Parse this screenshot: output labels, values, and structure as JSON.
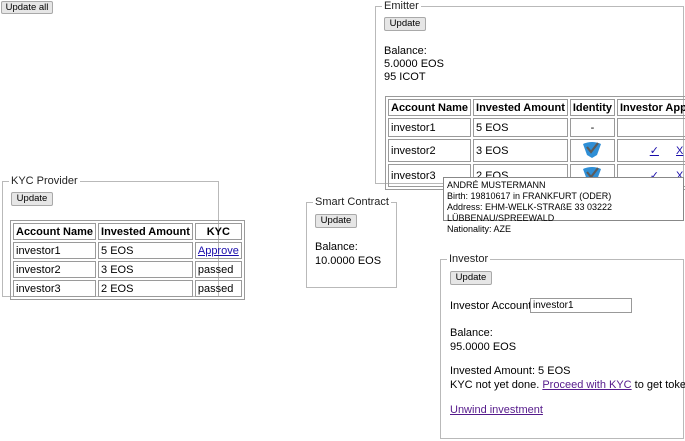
{
  "update_all_label": "Update all",
  "emitter": {
    "title": "Emitter",
    "update_label": "Update",
    "balance_label": "Balance:",
    "balance_eos": "5.0000 EOS",
    "balance_icot": "95 ICOT",
    "columns": [
      "Account Name",
      "Invested Amount",
      "Identity",
      "Investor Approval"
    ],
    "rows": [
      {
        "account": "investor1",
        "amount": "5 EOS",
        "identity": "-"
      },
      {
        "account": "investor2",
        "amount": "3 EOS",
        "identity": "verified-shield-icon",
        "approve": "✓",
        "reject": "X"
      },
      {
        "account": "investor3",
        "amount": "2 EOS",
        "identity": "verified-shield-icon",
        "approve": "✓",
        "reject": "X"
      }
    ]
  },
  "tooltip": {
    "name": "ANDRÉ MUSTERMANN",
    "birth": "Birth: 19810617 in FRANKFURT (ODER)",
    "address": "Address: EHM-WELK-STRAßE 33 03222 LÜBBENAU/SPREEWALD",
    "nationality": "Nationality: AZE"
  },
  "kyc_provider": {
    "title": "KYC Provider",
    "update_label": "Update",
    "columns": [
      "Account Name",
      "Invested Amount",
      "KYC"
    ],
    "rows": [
      {
        "account": "investor1",
        "amount": "5 EOS",
        "kyc": "Approve"
      },
      {
        "account": "investor2",
        "amount": "3 EOS",
        "kyc": "passed"
      },
      {
        "account": "investor3",
        "amount": "2 EOS",
        "kyc": "passed"
      }
    ]
  },
  "smart_contract": {
    "title": "Smart Contract",
    "update_label": "Update",
    "balance_label": "Balance:",
    "balance_eos": "10.0000 EOS"
  },
  "investor": {
    "title": "Investor",
    "update_label": "Update",
    "account_label": "Investor Account:",
    "account_value": "investor1",
    "balance_label": "Balance:",
    "balance_eos": "95.0000 EOS",
    "invested_amount": "Invested Amount: 5 EOS",
    "kyc_prefix": "KYC not yet done.",
    "kyc_link": "Proceed with KYC",
    "kyc_suffix": "to get tokens.",
    "unwind_link": "Unwind investment"
  },
  "colors": {
    "link": "#1a0dab",
    "visited_link": "#551a8b",
    "shield_blue": "#2f8fd6"
  }
}
